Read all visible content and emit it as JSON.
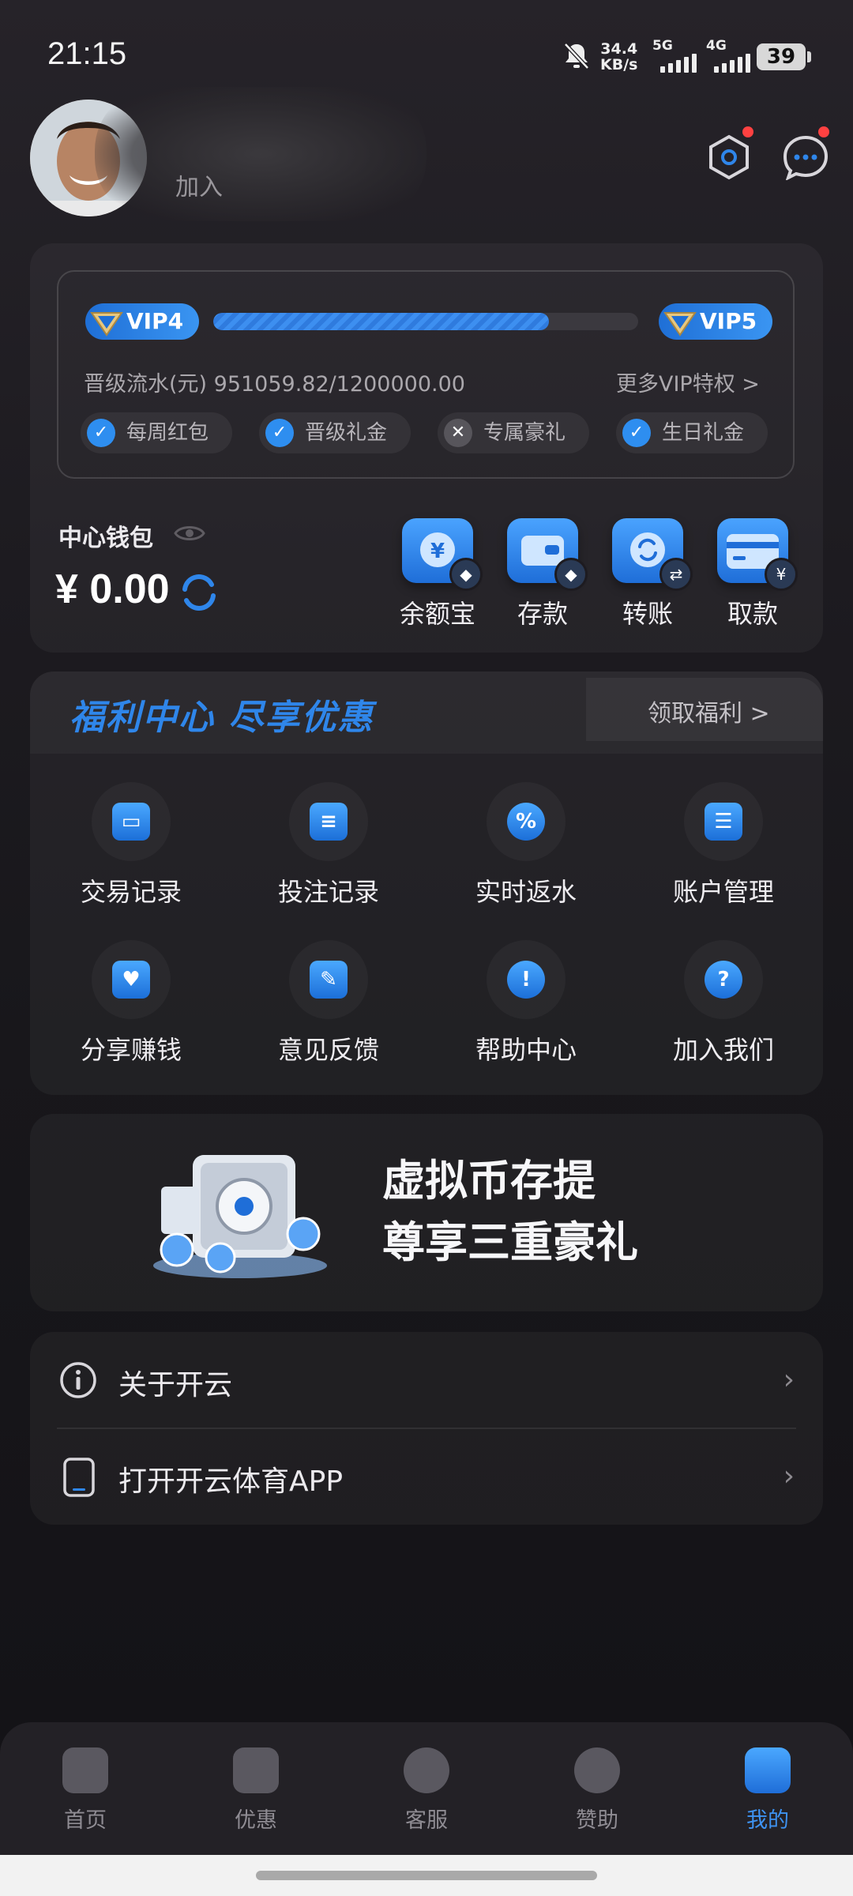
{
  "status_bar": {
    "time": "21:15",
    "net_speed": "34.4",
    "net_unit": "KB/s",
    "sim1": "5G",
    "sim2": "4G",
    "battery": "39"
  },
  "profile": {
    "name_fragment": "加入",
    "settings_icon": "hexagon-settings-icon",
    "message_icon": "chat-bubble-icon"
  },
  "vip": {
    "current": "VIP4",
    "next": "VIP5",
    "progress": 0.79,
    "flow_label": "晋级流水(元) 951059.82/1200000.00",
    "more": "更多VIP特权 >",
    "perks": [
      {
        "label": "每周红包",
        "status": "yes"
      },
      {
        "label": "晋级礼金",
        "status": "yes"
      },
      {
        "label": "专属豪礼",
        "status": "no"
      },
      {
        "label": "生日礼金",
        "status": "yes"
      }
    ]
  },
  "wallet": {
    "label": "中心钱包",
    "balance": "¥ 0.00",
    "actions": [
      {
        "label": "余额宝",
        "icon": "yuan-coin-icon"
      },
      {
        "label": "存款",
        "icon": "wallet-icon"
      },
      {
        "label": "转账",
        "icon": "transfer-icon"
      },
      {
        "label": "取款",
        "icon": "card-icon"
      }
    ]
  },
  "welfare": {
    "title": "福利中心 尽享优惠",
    "claim": "领取福利 >",
    "items": [
      {
        "label": "交易记录",
        "icon": "wallet-record-icon"
      },
      {
        "label": "投注记录",
        "icon": "calendar-bet-icon"
      },
      {
        "label": "实时返水",
        "icon": "percent-badge-icon"
      },
      {
        "label": "账户管理",
        "icon": "id-card-icon"
      },
      {
        "label": "分享赚钱",
        "icon": "heart-handshake-icon"
      },
      {
        "label": "意见反馈",
        "icon": "feedback-edit-icon"
      },
      {
        "label": "帮助中心",
        "icon": "exclamation-icon"
      },
      {
        "label": "加入我们",
        "icon": "question-icon"
      }
    ]
  },
  "banner": {
    "line1": "虚拟币存提",
    "line2": "尊享三重豪礼"
  },
  "list": [
    {
      "label": "关于开云",
      "icon": "info-icon"
    },
    {
      "label": "打开开云体育APP",
      "icon": "phone-icon"
    }
  ],
  "nav": [
    {
      "label": "首页",
      "icon": "home-icon",
      "active": false
    },
    {
      "label": "优惠",
      "icon": "gift-icon",
      "active": false
    },
    {
      "label": "客服",
      "icon": "headset-icon",
      "active": false
    },
    {
      "label": "赞助",
      "icon": "medal-icon",
      "active": false
    },
    {
      "label": "我的",
      "icon": "profile-icon",
      "active": true
    }
  ],
  "colors": {
    "accent": "#2f86ea",
    "background": "#1d1b20",
    "active_nav": "#3e93f2"
  }
}
